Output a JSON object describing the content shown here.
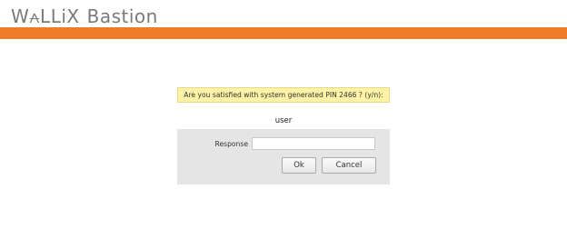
{
  "header": {
    "brand": "W⩜LLiX",
    "product": "Bastion",
    "accent_color": "#f07c2a"
  },
  "prompt": {
    "text": "Are you satisfied with system generated PIN 2466 ? (y/n):"
  },
  "form": {
    "username": "user",
    "response_label": "Response",
    "response_value": "",
    "ok_label": "Ok",
    "cancel_label": "Cancel"
  }
}
